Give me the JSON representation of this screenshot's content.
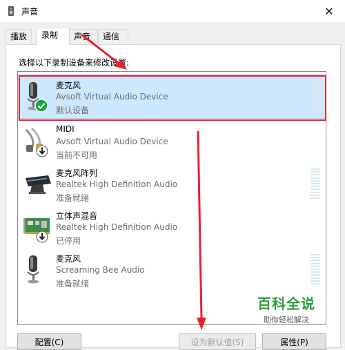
{
  "window": {
    "title": "声音",
    "close_glyph": "✕"
  },
  "tabs": [
    {
      "label": "播放",
      "active": false
    },
    {
      "label": "录制",
      "active": true
    },
    {
      "label": "声音",
      "active": false
    },
    {
      "label": "通信",
      "active": false
    }
  ],
  "instruction": "选择以下录制设备来修改设置:",
  "devices": [
    {
      "name": "麦克风",
      "description": "Avsoft Virtual Audio Device",
      "status": "默认设备",
      "icon": "microphone-icon",
      "badge": "default-check-icon",
      "meter": true
    },
    {
      "name": "MIDI",
      "description": "Avsoft Virtual Audio Device",
      "status": "当前不可用",
      "icon": "midi-cable-icon",
      "badge": "unavailable-arrow-icon",
      "meter": false
    },
    {
      "name": "麦克风阵列",
      "description": "Realtek High Definition Audio",
      "status": "准备就绪",
      "icon": "mic-array-icon",
      "badge": "",
      "meter": true
    },
    {
      "name": "立体声混音",
      "description": "Realtek High Definition Audio",
      "status": "已停用",
      "icon": "sound-card-icon",
      "badge": "disabled-arrow-icon",
      "meter": false
    },
    {
      "name": "麦克风",
      "description": "Screaming Bee Audio",
      "status": "准备就绪",
      "icon": "microphone-icon",
      "badge": "",
      "meter": true
    }
  ],
  "buttons": {
    "configure": "配置(C)",
    "set_default": "设为默认值(S)",
    "properties": "属性(P)"
  },
  "watermark": {
    "title": "百科全说",
    "subtitle": "助你轻松解决"
  },
  "colors": {
    "selection": "#cce8ff",
    "annotation_red": "#e8212d",
    "check_green": "#1aa53a",
    "watermark_green": "#2d9c3d"
  }
}
